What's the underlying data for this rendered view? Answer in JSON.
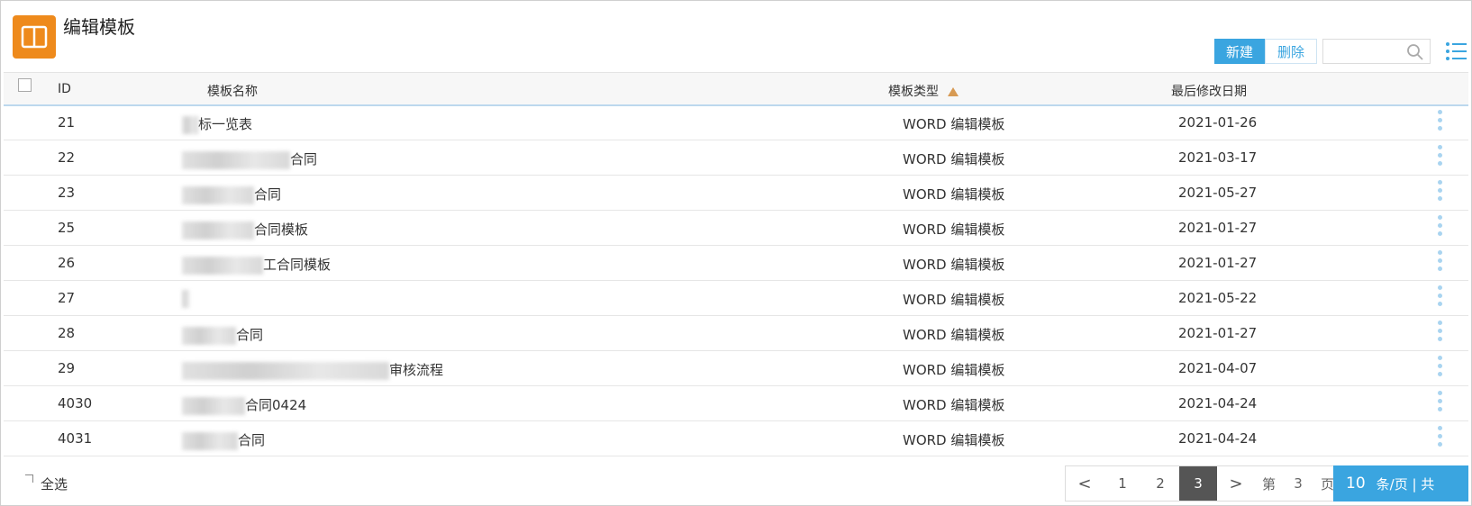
{
  "header": {
    "title": "编辑模板"
  },
  "toolbar": {
    "new_label": "新建",
    "delete_label": "删除",
    "search_placeholder": ""
  },
  "table": {
    "columns": {
      "id": "ID",
      "name": "模板名称",
      "type": "模板类型",
      "date": "最后修改日期"
    },
    "rows": [
      {
        "id": "21",
        "name": "标一览表",
        "type": "WORD 编辑模板",
        "date": "2021-01-26"
      },
      {
        "id": "22",
        "name": "合同",
        "type": "WORD 编辑模板",
        "date": "2021-03-17"
      },
      {
        "id": "23",
        "name": "合同",
        "type": "WORD 编辑模板",
        "date": "2021-05-27"
      },
      {
        "id": "25",
        "name": "合同模板",
        "type": "WORD 编辑模板",
        "date": "2021-01-27"
      },
      {
        "id": "26",
        "name": "工合同模板",
        "type": "WORD 编辑模板",
        "date": "2021-01-27"
      },
      {
        "id": "27",
        "name": "",
        "type": "WORD 编辑模板",
        "date": "2021-05-22"
      },
      {
        "id": "28",
        "name": "合同",
        "type": "WORD 编辑模板",
        "date": "2021-01-27"
      },
      {
        "id": "29",
        "name": "审核流程",
        "type": "WORD 编辑模板",
        "date": "2021-04-07"
      },
      {
        "id": "4030",
        "name": "合同0424",
        "type": "WORD 编辑模板",
        "date": "2021-04-24"
      },
      {
        "id": "4031",
        "name": "合同",
        "type": "WORD 编辑模板",
        "date": "2021-04-24"
      }
    ]
  },
  "footer": {
    "select_all": "全选",
    "pagination": {
      "prev": "<",
      "pages": [
        "1",
        "2",
        "3"
      ],
      "current": "3",
      "next": ">",
      "goto_prefix": "第",
      "goto_value": "3",
      "goto_suffix": "页"
    },
    "per_page": {
      "value": "10",
      "label": "条/页 | 共"
    }
  },
  "colors": {
    "accent": "#3aa5e0",
    "app_icon": "#ee8a1c",
    "sort_arrow": "#d79a53"
  }
}
